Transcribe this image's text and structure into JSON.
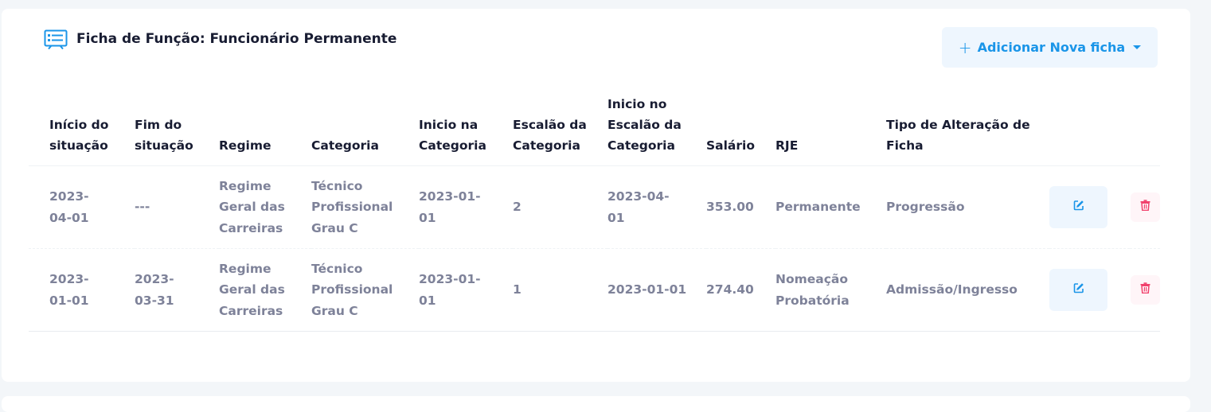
{
  "card": {
    "title": "Ficha de Função: Funcionário Permanente",
    "title_icon": "document-list-icon",
    "add_button": {
      "plus": "+",
      "label": "Adicionar Nova ficha",
      "caret_icon": "caret-down-icon"
    }
  },
  "table": {
    "headers": {
      "inicio_situacao": "Início do situação",
      "fim_situacao": "Fim do situação",
      "regime": "Regime",
      "categoria": "Categoria",
      "inicio_categoria": "Inicio na Categoria",
      "escalao_categoria": "Escalão da Categoria",
      "inicio_escalao": "Inicio no Escalão da Categoria",
      "salario": "Salário",
      "rje": "RJE",
      "tipo_alteracao": "Tipo de Alteração de Ficha"
    },
    "rows": [
      {
        "inicio_situacao": "2023-04-01",
        "fim_situacao": "---",
        "regime": "Regime Geral das Carreiras",
        "categoria": "Técnico Profissional Grau C",
        "inicio_categoria": "2023-01-01",
        "escalao_categoria": "2",
        "inicio_escalao": "2023-04-01",
        "salario": "353.00",
        "rje": "Permanente",
        "tipo_alteracao": "Progressão"
      },
      {
        "inicio_situacao": "2023-01-01",
        "fim_situacao": "2023-03-31",
        "regime": "Regime Geral das Carreiras",
        "categoria": "Técnico Profissional Grau C",
        "inicio_categoria": "2023-01-01",
        "escalao_categoria": "1",
        "inicio_escalao": "2023-01-01",
        "salario": "274.40",
        "rje": "Nomeação Probatória",
        "tipo_alteracao": "Admissão/Ingresso"
      }
    ],
    "row_actions": {
      "edit_icon": "edit-icon",
      "delete_icon": "trash-icon"
    }
  },
  "colors": {
    "accent": "#1a95e8",
    "danger": "#f1416c",
    "muted_text": "#7e8299",
    "heading_text": "#181c32"
  }
}
